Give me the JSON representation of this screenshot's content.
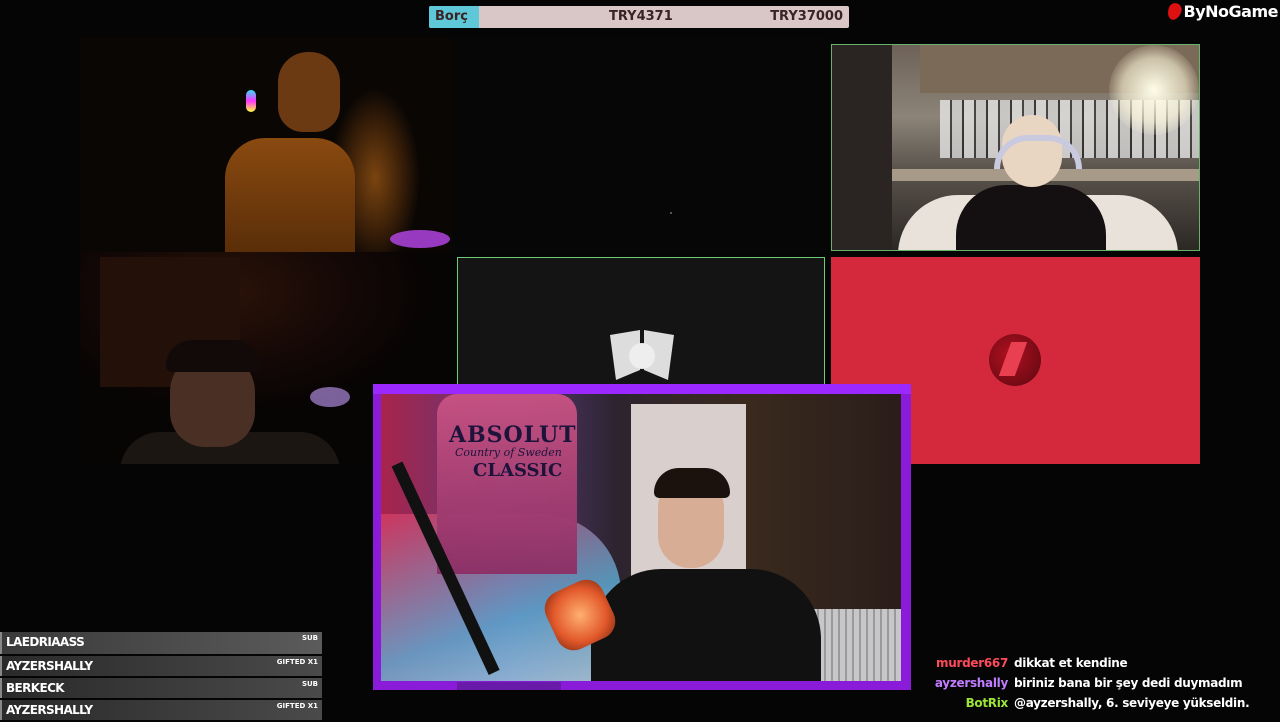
{
  "top_bar": {
    "left_label": "Borç",
    "current_value": "TRY4371",
    "goal_value": "TRY37000",
    "progress_fraction": 0.118,
    "fill_color": "#5ec8d8",
    "bar_color": "#d9c7c7"
  },
  "logo": {
    "text": "ByNoGame"
  },
  "cameras": {
    "main_overlay": {
      "bottle_line1": "ABSOLUT",
      "bottle_line2": "Country of Sweden",
      "bottle_line3": "CLASSIC"
    },
    "frame_color": "#8a1bd8",
    "active_border_color": "#6ecc77",
    "red_tile_color": "#d4283c"
  },
  "alerts": [
    {
      "name": "LAEDRIAASS",
      "tag": "SUB"
    },
    {
      "name": "AYZERSHALLY",
      "tag": "GIFTED X1"
    },
    {
      "name": "BERKECK",
      "tag": "SUB"
    },
    {
      "name": "AYZERSHALLY",
      "tag": "GIFTED X1"
    }
  ],
  "chat": [
    {
      "user": "murder667",
      "color": "#ff4a5a",
      "text": "dikkat et kendine"
    },
    {
      "user": "ayzershally",
      "color": "#c27cff",
      "text": "biriniz bana bir şey dedi duymadım"
    },
    {
      "user": "BotRix",
      "color": "#9be53b",
      "text": "@ayzershally, 6. seviyeye yükseldin."
    }
  ]
}
